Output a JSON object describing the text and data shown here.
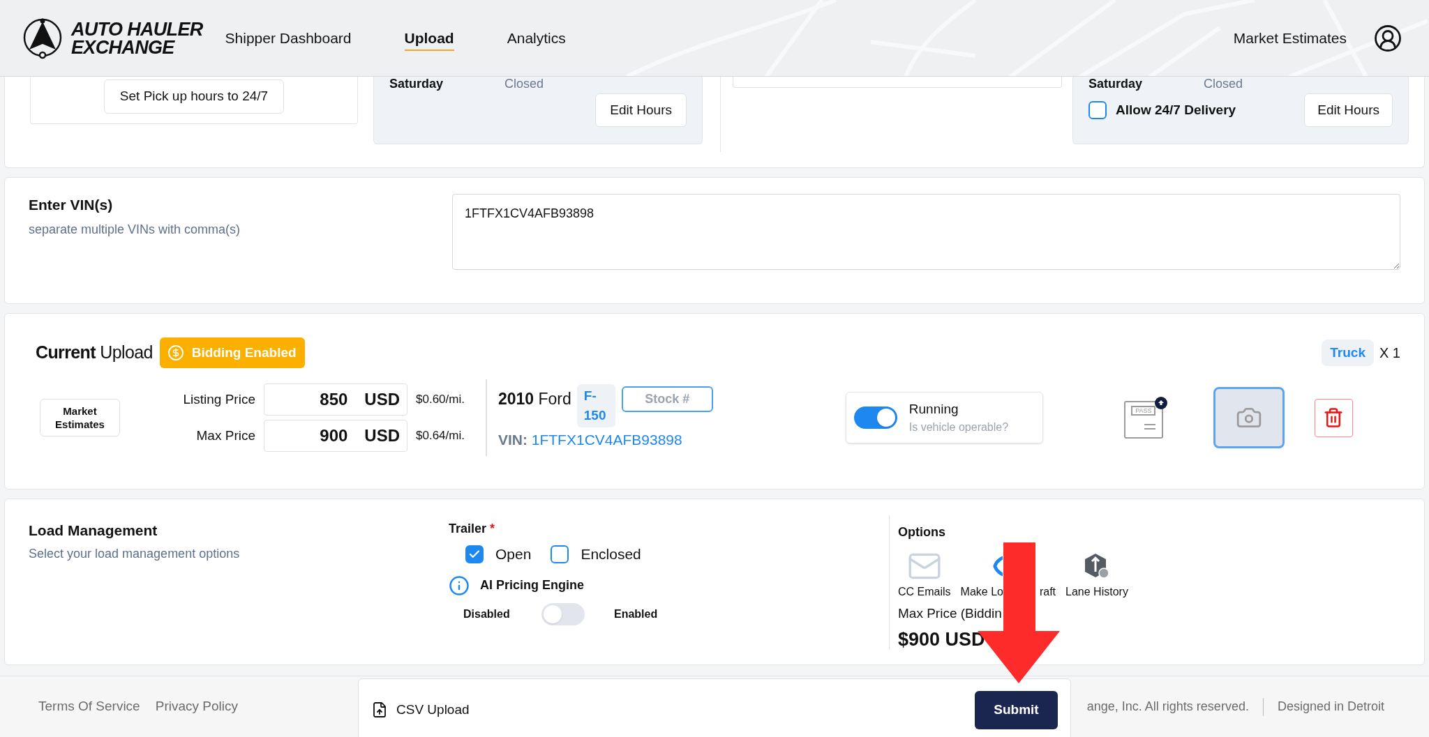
{
  "header": {
    "logo_line1": "AUTO HAULER",
    "logo_line2": "EXCHANGE",
    "nav": [
      {
        "label": "Shipper Dashboard",
        "selected": false
      },
      {
        "label": "Upload",
        "selected": true
      },
      {
        "label": "Analytics",
        "selected": false
      }
    ],
    "market_estimates": "Market Estimates"
  },
  "hours": {
    "set_button": "Set Pick up hours to 24/7",
    "pickup": {
      "day": "Saturday",
      "status": "Closed",
      "edit": "Edit Hours"
    },
    "delivery": {
      "day": "Saturday",
      "status": "Closed",
      "allow_label": "Allow 24/7 Delivery",
      "allow_checked": false,
      "edit": "Edit Hours"
    }
  },
  "vin": {
    "title": "Enter VIN(s)",
    "hint": "separate multiple VINs with comma(s)",
    "value": "1FTFX1CV4AFB93898"
  },
  "upload": {
    "title": "**Current** Upload",
    "badge": "Bidding Enabled",
    "type_tag": "Truck",
    "count": "X 1",
    "market_button": "Market Estimates",
    "prices": [
      {
        "label": "Listing Price",
        "value": "850",
        "currency": "USD",
        "per_mile": "$0.60/mi."
      },
      {
        "label": "Max Price",
        "value": "900",
        "currency": "USD",
        "per_mile": "$0.64/mi."
      }
    ],
    "vehicle": {
      "year": "2010",
      "make": "Ford",
      "model": "F-150",
      "stock_placeholder": "Stock #",
      "vin_label": "VIN:",
      "vin": "1FTFX1CV4AFB93898"
    },
    "running": {
      "label": "Running",
      "hint": "Is vehicle operable?",
      "on": true
    },
    "pass_label": "PASS"
  },
  "load": {
    "title": "Load Management",
    "hint": "Select your load management options",
    "trailer_label": "Trailer",
    "required_mark": "*",
    "trailer_options": [
      {
        "label": "Open",
        "checked": true
      },
      {
        "label": "Enclosed",
        "checked": false
      }
    ],
    "ai": {
      "label": "AI Pricing Engine",
      "off_label": "Disabled",
      "on_label": "Enabled",
      "on": false
    },
    "options_title": "Options",
    "options": [
      {
        "kind": "mail",
        "label": "CC Emails"
      },
      {
        "kind": "eye",
        "label": "Make Lo",
        "label_tail": "raft"
      },
      {
        "kind": "lane",
        "label": "Lane History"
      }
    ],
    "max_price_label": "Max Price (Biddin",
    "max_price": "$900 USD"
  },
  "footer": {
    "links": [
      "Terms Of Service",
      "Privacy Policy"
    ],
    "copyright": "ange, Inc. All rights reserved.",
    "designed": "Designed in Detroit",
    "csv_upload": "CSV Upload",
    "submit": "Submit"
  }
}
